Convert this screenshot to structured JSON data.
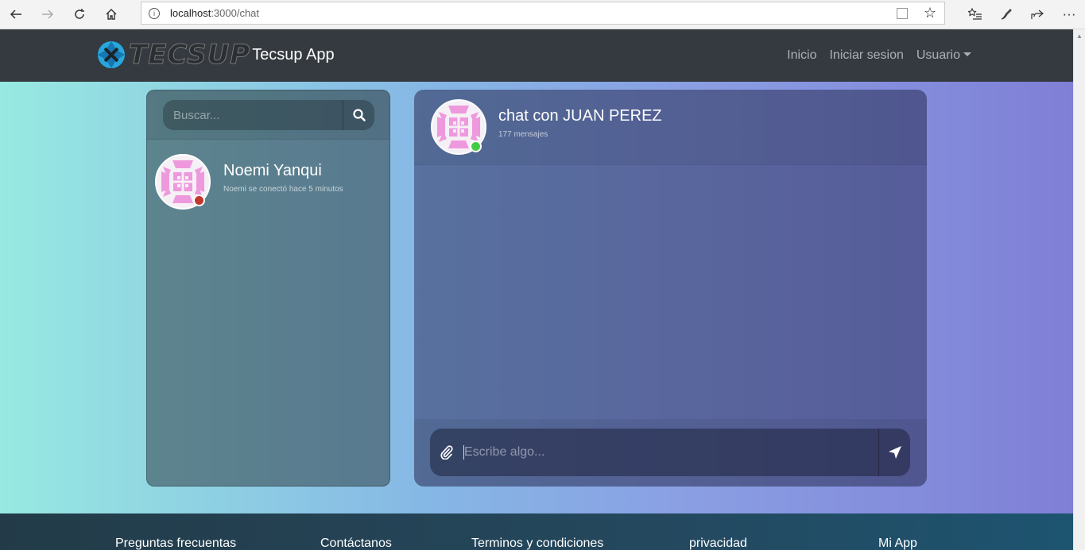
{
  "browser": {
    "url_host": "localhost",
    "url_path": ":3000/chat"
  },
  "navbar": {
    "logo_text": "TECSUP",
    "brand": "Tecsup App",
    "links": [
      "Inicio",
      "Iniciar sesion",
      "Usuario"
    ]
  },
  "contacts": {
    "search_placeholder": "Buscar...",
    "items": [
      {
        "name": "Noemi Yanqui",
        "status_text": "Noemi se conectó hace 5 minutos",
        "status_color": "#c0392b"
      }
    ]
  },
  "chat": {
    "title": "chat con JUAN PEREZ",
    "message_count": "177 mensajes",
    "status_color": "#44cc44",
    "input_placeholder": "Escribe algo..."
  },
  "footer": {
    "links": [
      "Preguntas frecuentas",
      "Contáctanos",
      "Terminos y condiciones",
      "privacidad",
      "Mi App"
    ]
  },
  "colors": {
    "navbar": "#343a40",
    "avatar_pattern": "#ee99dd"
  }
}
